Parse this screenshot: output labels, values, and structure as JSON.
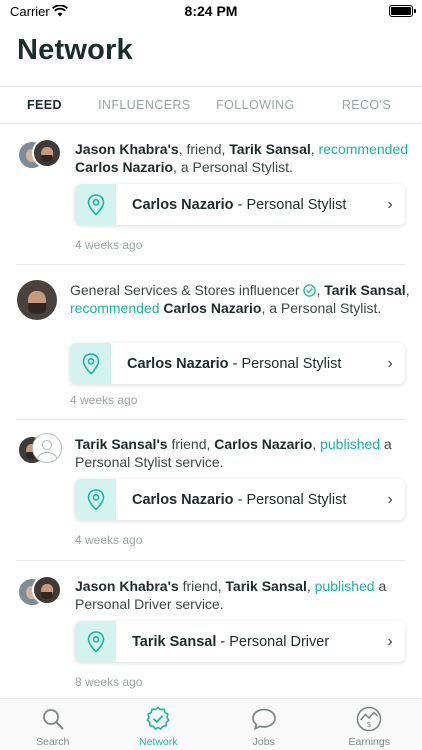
{
  "status_bar": {
    "carrier": "Carrier",
    "time": "8:24 PM"
  },
  "page_title": "Network",
  "tabs": [
    {
      "label": "FEED",
      "active": true
    },
    {
      "label": "INFLUENCERS",
      "active": false
    },
    {
      "label": "FOLLOWING",
      "active": false
    },
    {
      "label": "RECO'S",
      "active": false
    }
  ],
  "feed": [
    {
      "story": {
        "p1": "Jason Khabra's",
        "p2": ", friend, ",
        "p3": "Tarik Sansal",
        "p4": ", ",
        "p5": "recommended",
        "p6": "Carlos Nazario",
        "p7": ", a Personal Stylist."
      },
      "card": {
        "name": "Carlos Nazario",
        "separator": " - ",
        "service": "Personal Stylist"
      },
      "time": "4 weeks ago"
    },
    {
      "story": {
        "p1": "General Services & Stores influencer",
        "p2": "Tarik Sansal",
        "p3": ", ",
        "p4": "recommended",
        "p5": "Carlos Nazario",
        "p6": ", a Personal Stylist."
      },
      "card": {
        "name": "Carlos Nazario",
        "separator": " - ",
        "service": "Personal Stylist"
      },
      "time": "4 weeks ago"
    },
    {
      "story": {
        "p1": "Tarik Sansal's",
        "p2": " friend, ",
        "p3": "Carlos Nazario",
        "p4": ", ",
        "p5": "published",
        "p6": " a Personal Stylist service."
      },
      "card": {
        "name": "Carlos Nazario",
        "separator": " - ",
        "service": "Personal Stylist"
      },
      "time": "4 weeks ago"
    },
    {
      "story": {
        "p1": "Jason Khabra's",
        "p2": " friend, ",
        "p3": "Tarik Sansal",
        "p4": ", ",
        "p5": "published",
        "p6": " a Personal Driver service."
      },
      "card": {
        "name": "Tarik Sansal",
        "separator": " - ",
        "service": "Personal Driver"
      },
      "time": "8 weeks ago"
    }
  ],
  "bottom_nav": [
    {
      "label": "Search",
      "icon": "search-icon",
      "active": false
    },
    {
      "label": "Network",
      "icon": "network-badge-icon",
      "active": true
    },
    {
      "label": "Jobs",
      "icon": "chat-bubble-icon",
      "active": false
    },
    {
      "label": "Earnings",
      "icon": "earnings-icon",
      "active": false
    }
  ],
  "colors": {
    "accent": "#19b5a3",
    "pin_bg": "#d5f3ee",
    "text": "#1d2b2a",
    "muted": "#9aa3a3"
  }
}
